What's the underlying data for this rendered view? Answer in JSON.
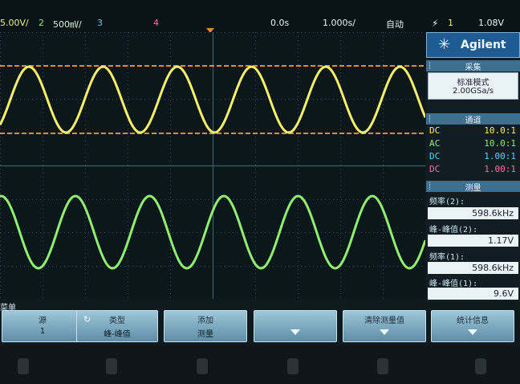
{
  "top_bar": {
    "ch1_scale": "5.00V/",
    "ch2_number": "2",
    "ch2_scale": "500㎷/",
    "ch3_number": "3",
    "ch4_number": "4",
    "time_position": "0.0s",
    "time_scale": "1.000s/",
    "trigger_mode": "自动",
    "trigger_icon": "trigger-edge-icon",
    "trigger_source": "1",
    "trigger_level": "1.08V"
  },
  "panel": {
    "brand": "Agilent",
    "acquire_header": "采集",
    "acquire_mode": "标准模式",
    "sample_rate": "2.00GSa/s",
    "channels_header": "通道",
    "channels": [
      {
        "coupling": "DC",
        "probe": "10.0:1",
        "color": "#f6ef6a"
      },
      {
        "coupling": "AC",
        "probe": "10.0:1",
        "color": "#8ef06e"
      },
      {
        "coupling": "DC",
        "probe": "1.00:1",
        "color": "#5cd2ff"
      },
      {
        "coupling": "DC",
        "probe": "1.00:1",
        "color": "#ff6fa8"
      }
    ],
    "measure_header": "测量",
    "measurements": [
      {
        "label": "频率(2):",
        "value": "598.6kHz"
      },
      {
        "label": "峰-峰值(2):",
        "value": "1.17V"
      },
      {
        "label": "频率(1):",
        "value": "598.6kHz"
      },
      {
        "label": "峰-峰值(1):",
        "value": "9.6V"
      }
    ]
  },
  "menu": {
    "title": "菜单",
    "softkeys": [
      {
        "line1": "源",
        "line2": "1"
      },
      {
        "line1": "类型",
        "line2": "峰-峰值"
      },
      {
        "line1": "添加",
        "line2": "测量"
      },
      {
        "line1": "",
        "line2": ""
      },
      {
        "line1": "清除测量值",
        "line2": ""
      },
      {
        "line1": "统计信息",
        "line2": ""
      }
    ]
  },
  "colors": {
    "ch1": "#f6ef6a",
    "ch2": "#8ef06e",
    "cursor": "#e8892c",
    "grid": "#3f5d66"
  }
}
